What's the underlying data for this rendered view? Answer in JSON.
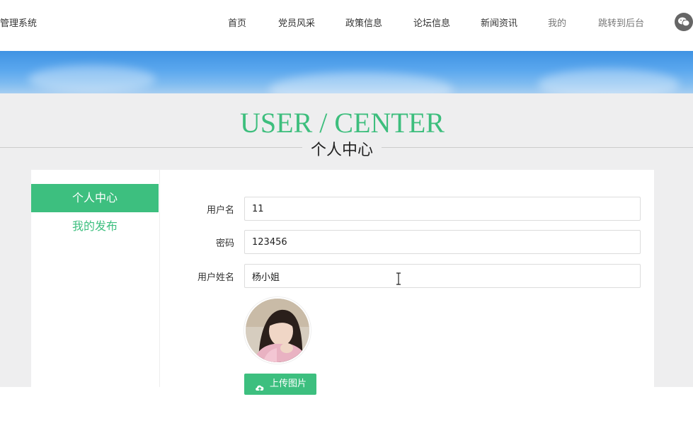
{
  "header": {
    "brand": "管理系统",
    "nav": [
      {
        "label": "首页"
      },
      {
        "label": "党员风采"
      },
      {
        "label": "政策信息"
      },
      {
        "label": "论坛信息"
      },
      {
        "label": "新闻资讯"
      },
      {
        "label": "我的"
      },
      {
        "label": "跳转到后台"
      }
    ],
    "wechat_icon": "wechat-icon"
  },
  "page": {
    "title_en": "USER / CENTER",
    "title_cn": "个人中心"
  },
  "sidebar": {
    "items": [
      {
        "label": "个人中心",
        "active": true
      },
      {
        "label": "我的发布",
        "active": false
      }
    ]
  },
  "form": {
    "username": {
      "label": "用户名",
      "value": "11"
    },
    "password": {
      "label": "密码",
      "value": "123456"
    },
    "realname": {
      "label": "用户姓名",
      "value": "杨小姐"
    },
    "upload_label": "上传图片",
    "upload_icon": "upload-cloud-icon"
  },
  "colors": {
    "accent": "#3dbf7f",
    "banner": "#4a9de8",
    "content_bg": "#eeeeef"
  }
}
